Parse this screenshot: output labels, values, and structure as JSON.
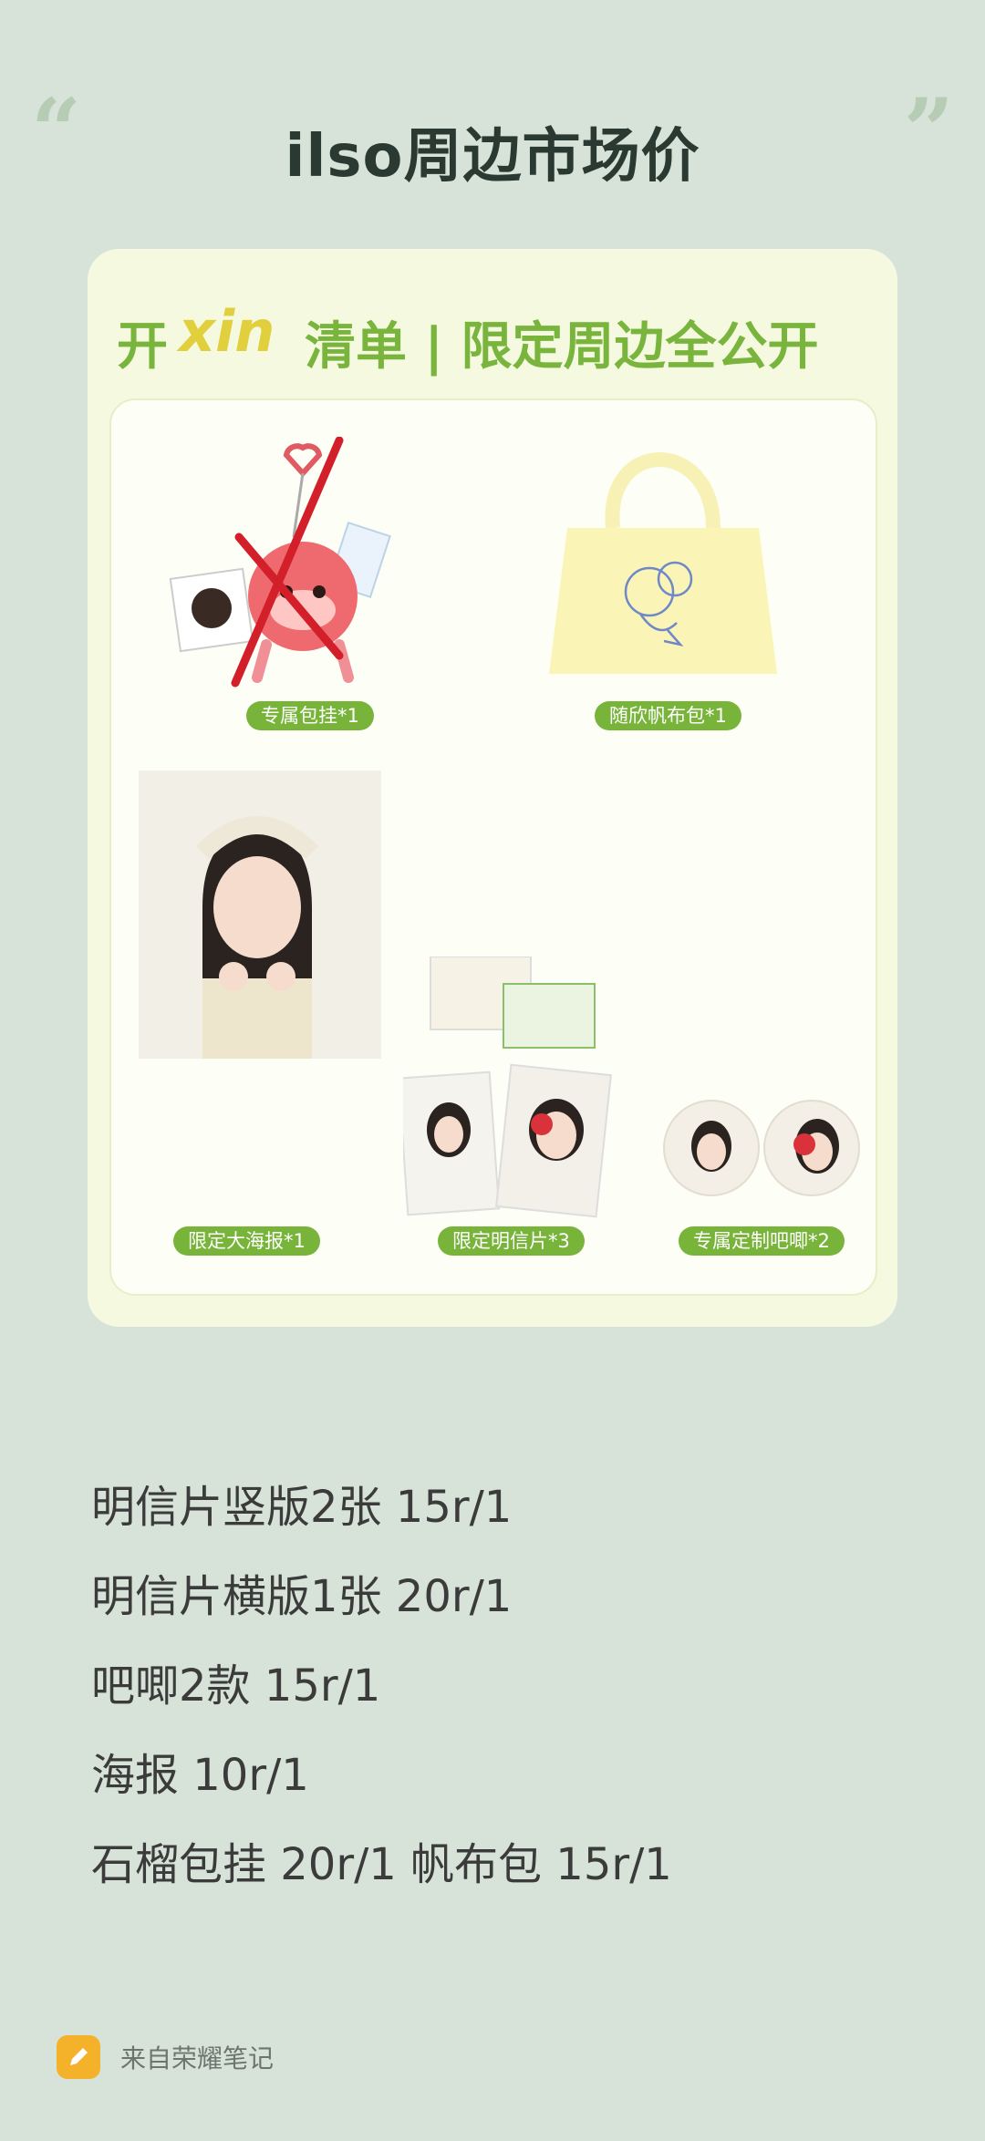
{
  "header": {
    "title": "ilso周边市场价"
  },
  "card": {
    "head_left": "开",
    "head_xin": "xin",
    "head_rest": "清单 | 限定周边全公开",
    "items": [
      {
        "label": "专属包挂*1"
      },
      {
        "label": "随欣帆布包*1"
      },
      {
        "label": "限定大海报*1"
      },
      {
        "label": "限定明信片*3"
      },
      {
        "label": "专属定制吧唧*2"
      }
    ]
  },
  "prices": [
    "明信片竖版2张 15r/1",
    "明信片横版1张 20r/1",
    "吧唧2款 15r/1",
    "海报 10r/1",
    "石榴包挂 20r/1 帆布包 15r/1"
  ],
  "footer": {
    "source_label": "来自荣耀笔记"
  },
  "colors": {
    "background": "#d7e3d8",
    "accent_green": "#78b43a",
    "cross_red": "#d21f2a",
    "note_icon": "#f3b22a"
  }
}
